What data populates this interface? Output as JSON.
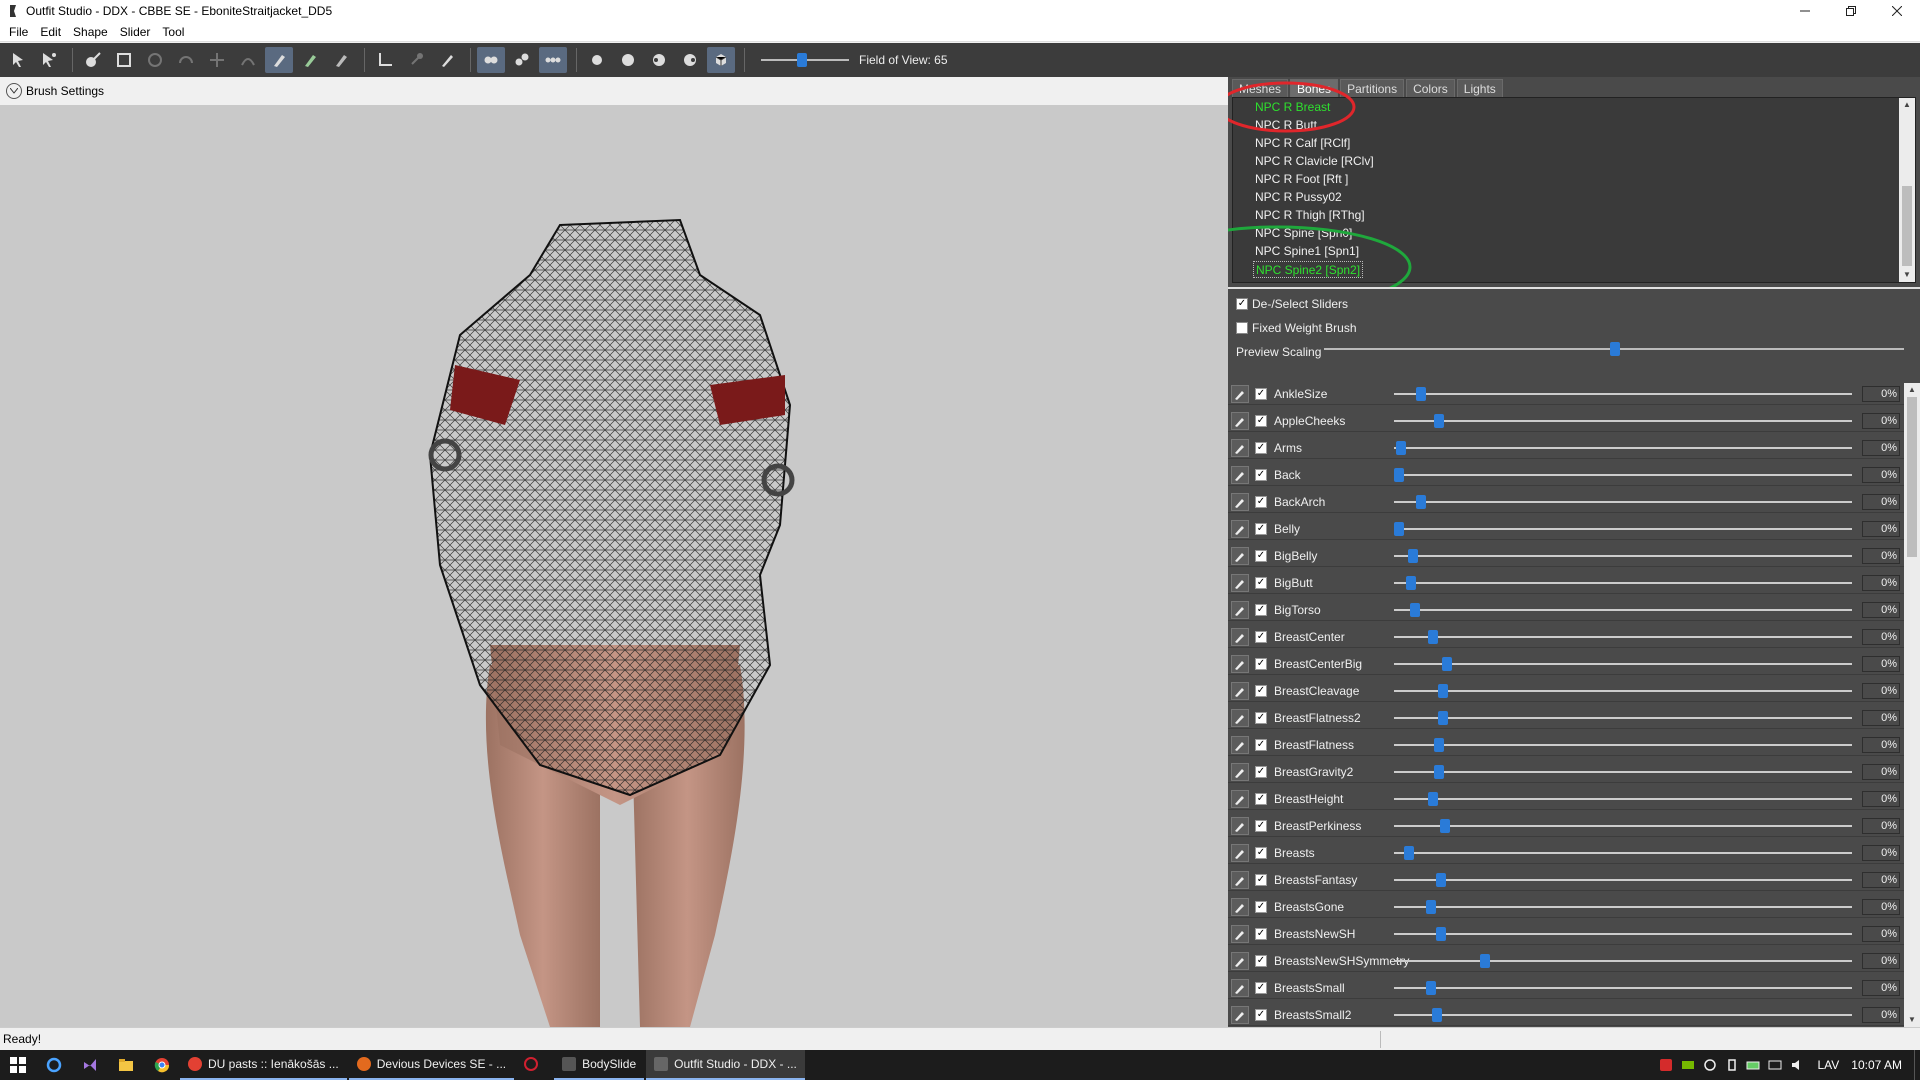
{
  "window": {
    "title": "Outfit Studio - DDX - CBBE SE - EboniteStraitjacket_DD5",
    "minimize_icon": "minimize-icon",
    "maximize_icon": "restore-icon",
    "close_icon": "close-icon"
  },
  "menu": [
    "File",
    "Edit",
    "Shape",
    "Slider",
    "Tool"
  ],
  "toolbar": {
    "fov_label": "Field of View: 65",
    "fov_value": 65
  },
  "brush": {
    "label": "Brush Settings"
  },
  "panel": {
    "tabs": [
      "Meshes",
      "Bones",
      "Partitions",
      "Colors",
      "Lights"
    ],
    "active_tab": "Bones",
    "bones": [
      {
        "label": "NPC R Breast",
        "state": "green"
      },
      {
        "label": "NPC R Butt",
        "state": "normal"
      },
      {
        "label": "NPC R Calf [RClf]",
        "state": "normal"
      },
      {
        "label": "NPC R Clavicle [RClv]",
        "state": "normal"
      },
      {
        "label": "NPC R Foot [Rft ]",
        "state": "normal"
      },
      {
        "label": "NPC R Pussy02",
        "state": "normal"
      },
      {
        "label": "NPC R Thigh [RThg]",
        "state": "normal"
      },
      {
        "label": "NPC Spine [Spn0]",
        "state": "normal"
      },
      {
        "label": "NPC Spine1 [Spn1]",
        "state": "normal"
      },
      {
        "label": "NPC Spine2 [Spn2]",
        "state": "selected"
      }
    ],
    "deselect_sliders": "De-/Select Sliders",
    "fixed_weight_brush": "Fixed Weight Brush",
    "preview_scaling": "Preview Scaling",
    "preview_scaling_value": 0.5,
    "annotation_red": "#e0262b",
    "annotation_green": "#1fa83c"
  },
  "sliders": [
    {
      "name": "AnkleSize",
      "value": "0%",
      "pos": 0.0
    },
    {
      "name": "AppleCheeks",
      "value": "0%",
      "pos": 0.035
    },
    {
      "name": "Arms",
      "value": "0%",
      "pos": 0.0
    },
    {
      "name": "Back",
      "value": "0%",
      "pos": 0.0
    },
    {
      "name": "BackArch",
      "value": "0%",
      "pos": 0.0
    },
    {
      "name": "Belly",
      "value": "0%",
      "pos": 0.0
    },
    {
      "name": "BigBelly",
      "value": "0%",
      "pos": 0.0
    },
    {
      "name": "BigButt",
      "value": "0%",
      "pos": 0.0
    },
    {
      "name": "BigTorso",
      "value": "0%",
      "pos": 0.0
    },
    {
      "name": "BreastCenter",
      "value": "0%",
      "pos": 0.0
    },
    {
      "name": "BreastCenterBig",
      "value": "0%",
      "pos": 0.0
    },
    {
      "name": "BreastCleavage",
      "value": "0%",
      "pos": 0.0
    },
    {
      "name": "BreastFlatness2",
      "value": "0%",
      "pos": 0.0
    },
    {
      "name": "BreastFlatness",
      "value": "0%",
      "pos": 0.0
    },
    {
      "name": "BreastGravity2",
      "value": "0%",
      "pos": 0.0
    },
    {
      "name": "BreastHeight",
      "value": "0%",
      "pos": 0.0
    },
    {
      "name": "BreastPerkiness",
      "value": "0%",
      "pos": 0.0
    },
    {
      "name": "Breasts",
      "value": "0%",
      "pos": 0.0
    },
    {
      "name": "BreastsFantasy",
      "value": "0%",
      "pos": 0.0
    },
    {
      "name": "BreastsGone",
      "value": "0%",
      "pos": 0.0
    },
    {
      "name": "BreastsNewSH",
      "value": "0%",
      "pos": 0.0
    },
    {
      "name": "BreastsNewSHSymmetry",
      "value": "0%",
      "pos": 0.0
    },
    {
      "name": "BreastsSmall",
      "value": "0%",
      "pos": 0.0
    },
    {
      "name": "BreastsSmall2",
      "value": "0%",
      "pos": 0.0
    }
  ],
  "status": {
    "text": "Ready!"
  },
  "taskbar": {
    "apps": [
      {
        "label": "DU pasts :: Ienākošās ...",
        "icon": "chrome-icon",
        "state": "open"
      },
      {
        "label": "Devious Devices SE - ...",
        "icon": "firefox-icon",
        "state": "open"
      },
      {
        "label": "",
        "icon": "opera-icon",
        "state": "none"
      },
      {
        "label": "BodySlide",
        "icon": "bodyslide-icon",
        "state": "open"
      },
      {
        "label": "Outfit Studio - DDX - ...",
        "icon": "outfitstudio-icon",
        "state": "active"
      }
    ],
    "lang": "LAV",
    "time": "10:07 AM"
  }
}
